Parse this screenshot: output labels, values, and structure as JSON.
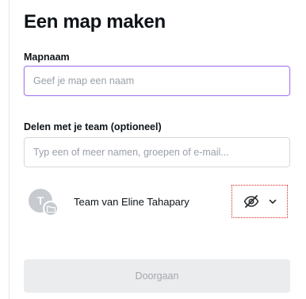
{
  "dialog": {
    "title": "Een map maken"
  },
  "folder_name": {
    "label": "Mapnaam",
    "placeholder": "Geef je map een naam",
    "value": ""
  },
  "share": {
    "label": "Delen met je team (optioneel)",
    "placeholder": "Typ een of meer namen, groepen of e-mail...",
    "value": ""
  },
  "team": {
    "avatar_initial": "T",
    "name": "Team van Eline Tahapary",
    "visibility_icon": "eye-slash-icon",
    "dropdown_icon": "chevron-down-icon"
  },
  "actions": {
    "continue_label": "Doorgaan"
  },
  "colors": {
    "focus_border": "#a77cf4",
    "highlight_dotted": "#d92626",
    "disabled_button_bg": "#ebeced",
    "disabled_button_text": "#a3a7ad"
  }
}
